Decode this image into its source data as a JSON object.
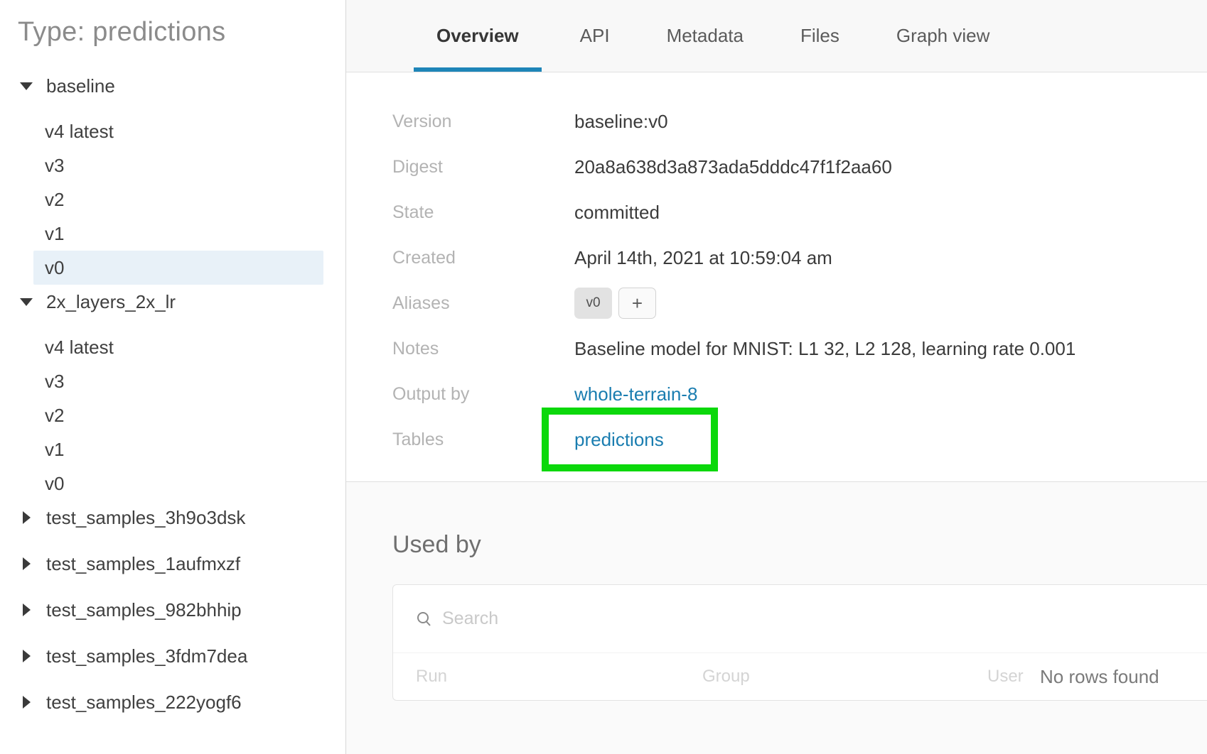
{
  "sidebar": {
    "title": "Type: predictions",
    "groups": [
      {
        "name": "baseline",
        "expanded": true,
        "versions": [
          "v4 latest",
          "v3",
          "v2",
          "v1",
          "v0"
        ],
        "selected_version": "v0"
      },
      {
        "name": "2x_layers_2x_lr",
        "expanded": true,
        "versions": [
          "v4 latest",
          "v3",
          "v2",
          "v1",
          "v0"
        ]
      },
      {
        "name": "test_samples_3h9o3dsk",
        "expanded": false
      },
      {
        "name": "test_samples_1aufmxzf",
        "expanded": false
      },
      {
        "name": "test_samples_982bhhip",
        "expanded": false
      },
      {
        "name": "test_samples_3fdm7dea",
        "expanded": false
      },
      {
        "name": "test_samples_222yogf6",
        "expanded": false
      }
    ]
  },
  "tabs": [
    {
      "label": "Overview"
    },
    {
      "label": "API"
    },
    {
      "label": "Metadata"
    },
    {
      "label": "Files"
    },
    {
      "label": "Graph view"
    }
  ],
  "active_tab": "Overview",
  "overview": {
    "rows": [
      {
        "label": "Version",
        "value": "baseline:v0"
      },
      {
        "label": "Digest",
        "value": "20a8a638d3a873ada5dddc47f1f2aa60"
      },
      {
        "label": "State",
        "value": "committed"
      },
      {
        "label": "Created",
        "value": "April 14th, 2021 at 10:59:04 am"
      },
      {
        "label": "Aliases",
        "chips": [
          "v0"
        ],
        "add_button": "+"
      },
      {
        "label": "Notes",
        "value": "Baseline model for MNIST: L1 32, L2 128, learning rate 0.001"
      },
      {
        "label": "Output by",
        "link": "whole-terrain-8"
      },
      {
        "label": "Tables",
        "link": "predictions",
        "highlighted": true
      }
    ]
  },
  "used_by": {
    "heading": "Used by",
    "search_placeholder": "Search",
    "columns": [
      "Run",
      "Group",
      "User"
    ],
    "empty_text": "No rows found"
  },
  "colors": {
    "accent_blue": "#1e85b8",
    "link_blue": "#1a7db0",
    "highlight_green": "#0bd80b",
    "selected_row_bg": "#e8f1f8"
  }
}
